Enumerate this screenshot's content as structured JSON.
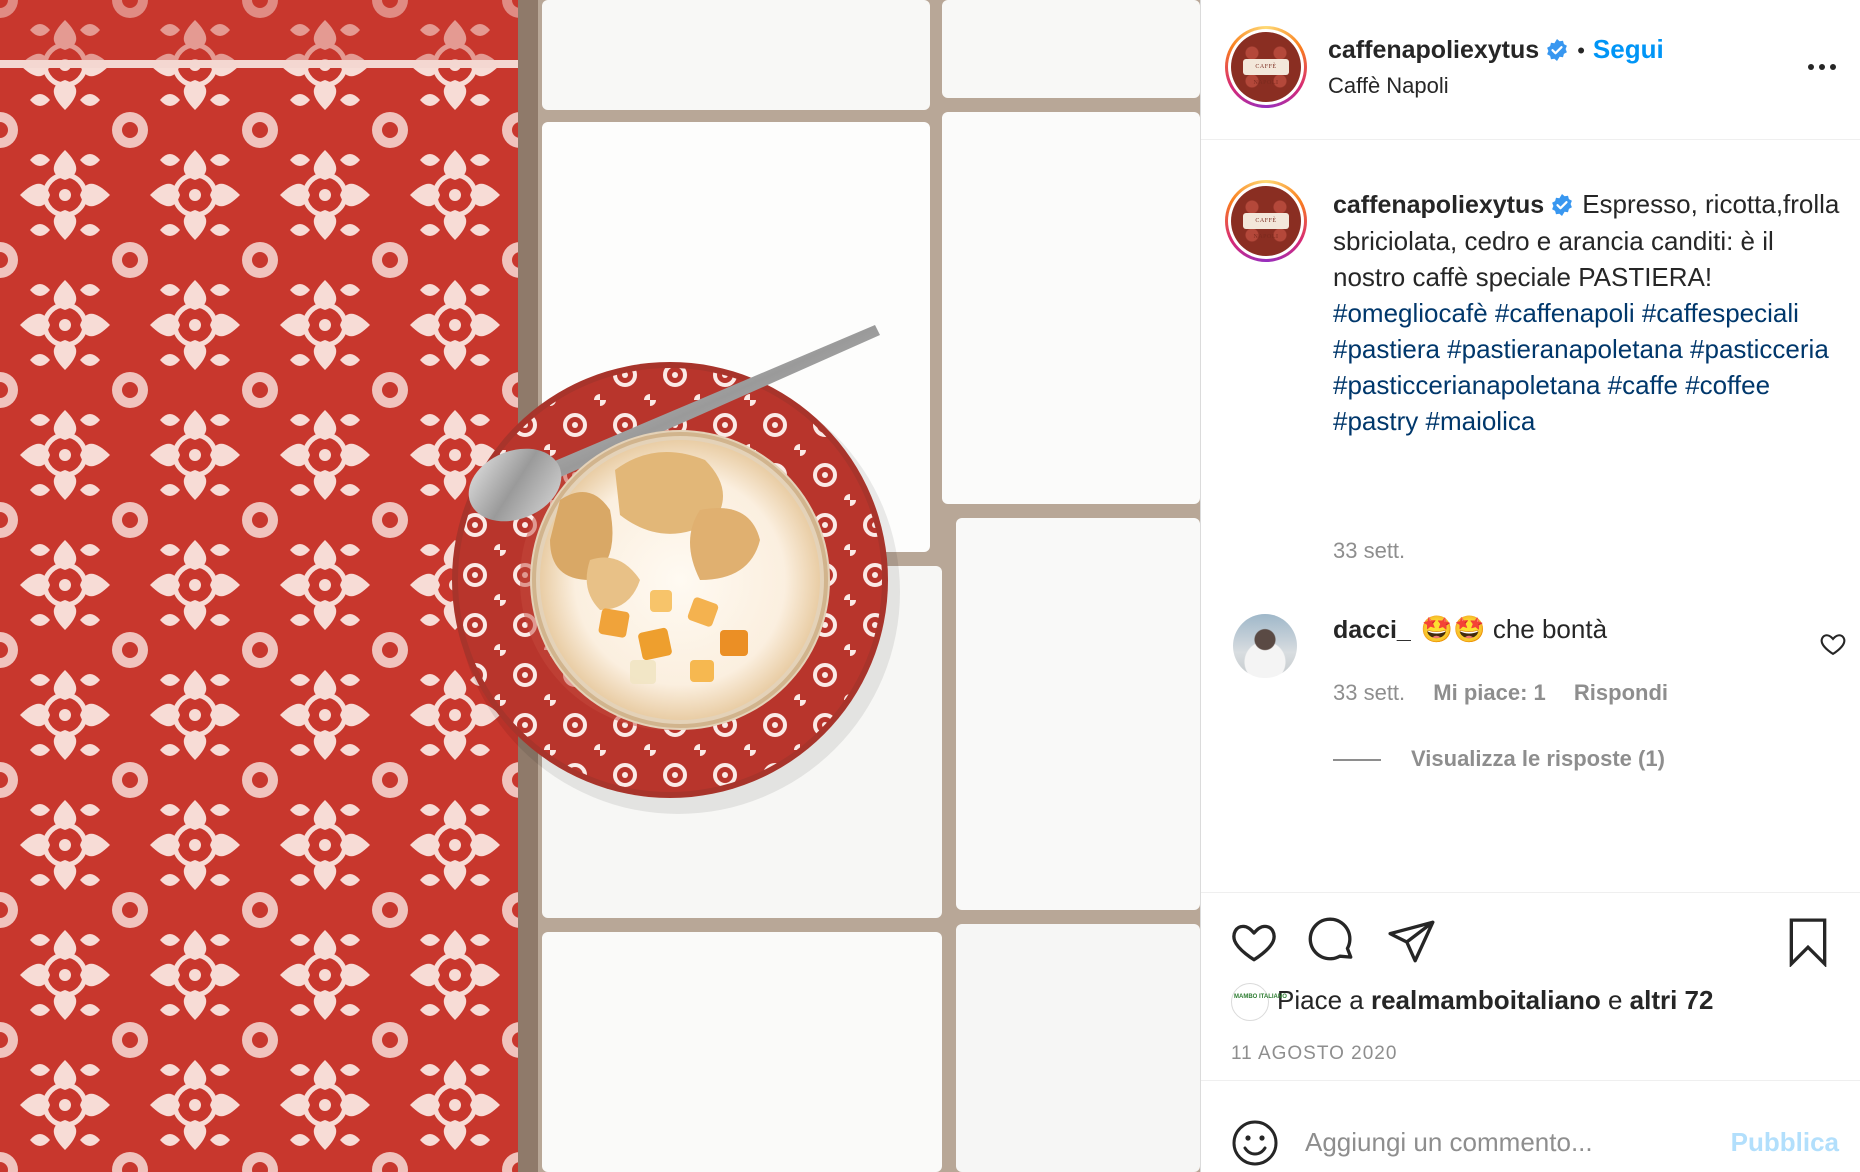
{
  "post": {
    "username": "caffenapoliexytus",
    "follow_dot": "•",
    "follow_label": "Segui",
    "location": "Caffè Napoli",
    "avatar_label": "CAFFÈ NAPOLI",
    "caption_text": "Espresso, ricotta,frolla sbriciolata, cedro e arancia canditi: è il nostro caffè speciale PASTIERA!",
    "hashtags": "#omegliocafè #caffenapoli #caffespeciali #pastiera #pastieranapoletana #pasticceria #pasticcerianapoletana #caffe #coffee #pastry #maiolica",
    "caption_time": "33 sett.",
    "likes_prefix": "Piace a",
    "likes_user": "realmamboitaliano",
    "likes_and": "e",
    "likes_others": "altri 72",
    "date": "11 AGOSTO 2020"
  },
  "comment": {
    "username": "dacci_",
    "emoji": "🤩🤩",
    "text": "che bontà",
    "time": "33 sett.",
    "likes": "Mi piace: 1",
    "reply": "Rispondi",
    "view_replies": "Visualizza le risposte (1)"
  },
  "add_comment": {
    "placeholder": "Aggiungi un commento...",
    "publish": "Pubblica"
  },
  "icons": [
    "verified-badge-icon",
    "more-options-icon",
    "heart-icon",
    "comment-icon",
    "share-icon",
    "bookmark-icon",
    "emoji-icon"
  ],
  "colors": {
    "accent": "#0095f6",
    "hashtag": "#00376b",
    "muted": "#8e8e8e",
    "publish_disabled": "#b2dffc",
    "tile_red": "#c8372d"
  }
}
